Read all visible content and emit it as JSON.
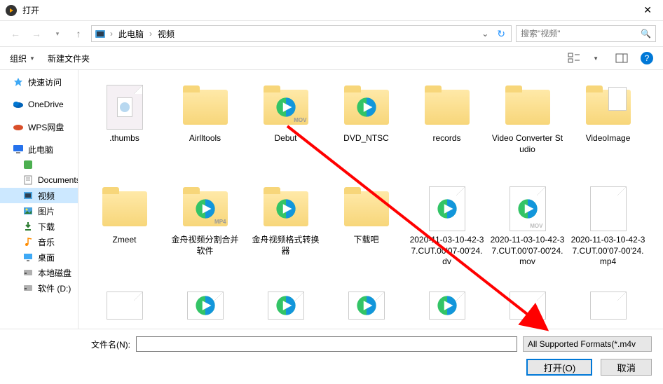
{
  "window": {
    "title": "打开"
  },
  "address": {
    "crumb1": "此电脑",
    "crumb2": "视频",
    "search_placeholder": "搜索\"视频\""
  },
  "toolbar": {
    "organize": "组织",
    "new_folder": "新建文件夹"
  },
  "sidebar": {
    "quick_access": "快速访问",
    "onedrive": "OneDrive",
    "wps": "WPS网盘",
    "this_pc": "此电脑",
    "documents": "Documents",
    "videos": "视频",
    "pictures": "图片",
    "downloads": "下载",
    "music": "音乐",
    "desktop": "桌面",
    "local_disk": "本地磁盘",
    "software": "软件 (D:)"
  },
  "files": [
    {
      "name": ".thumbs",
      "type": "thumbs"
    },
    {
      "name": "Airlltools",
      "type": "folder"
    },
    {
      "name": "Debut",
      "type": "folder-video",
      "tag": "MOV"
    },
    {
      "name": "DVD_NTSC",
      "type": "folder-video"
    },
    {
      "name": "records",
      "type": "folder"
    },
    {
      "name": "Video Converter Studio",
      "type": "folder"
    },
    {
      "name": "VideoImage",
      "type": "folder-paper"
    },
    {
      "name": "Zmeet",
      "type": "folder"
    },
    {
      "name": "金舟视频分割合并软件",
      "type": "folder-video",
      "tag": "MP4"
    },
    {
      "name": "金舟视频格式转换器",
      "type": "folder-video"
    },
    {
      "name": "下载吧",
      "type": "folder"
    },
    {
      "name": "2020-11-03-10-42-37.CUT.00'07-00'24.dv",
      "type": "file-video"
    },
    {
      "name": "2020-11-03-10-42-37.CUT.00'07-00'24.mov",
      "type": "file-video",
      "tag": "MOV"
    },
    {
      "name": "2020-11-03-10-42-37.CUT.00'07-00'24.mp4",
      "type": "file-blank"
    }
  ],
  "bottom": {
    "filename_label": "文件名(N):",
    "filename_value": "",
    "filetype": "All Supported Formats(*.m4v",
    "open": "打开(O)",
    "cancel": "取消"
  },
  "colors": {
    "accent": "#0078d7",
    "folder": "#f7d67a"
  }
}
